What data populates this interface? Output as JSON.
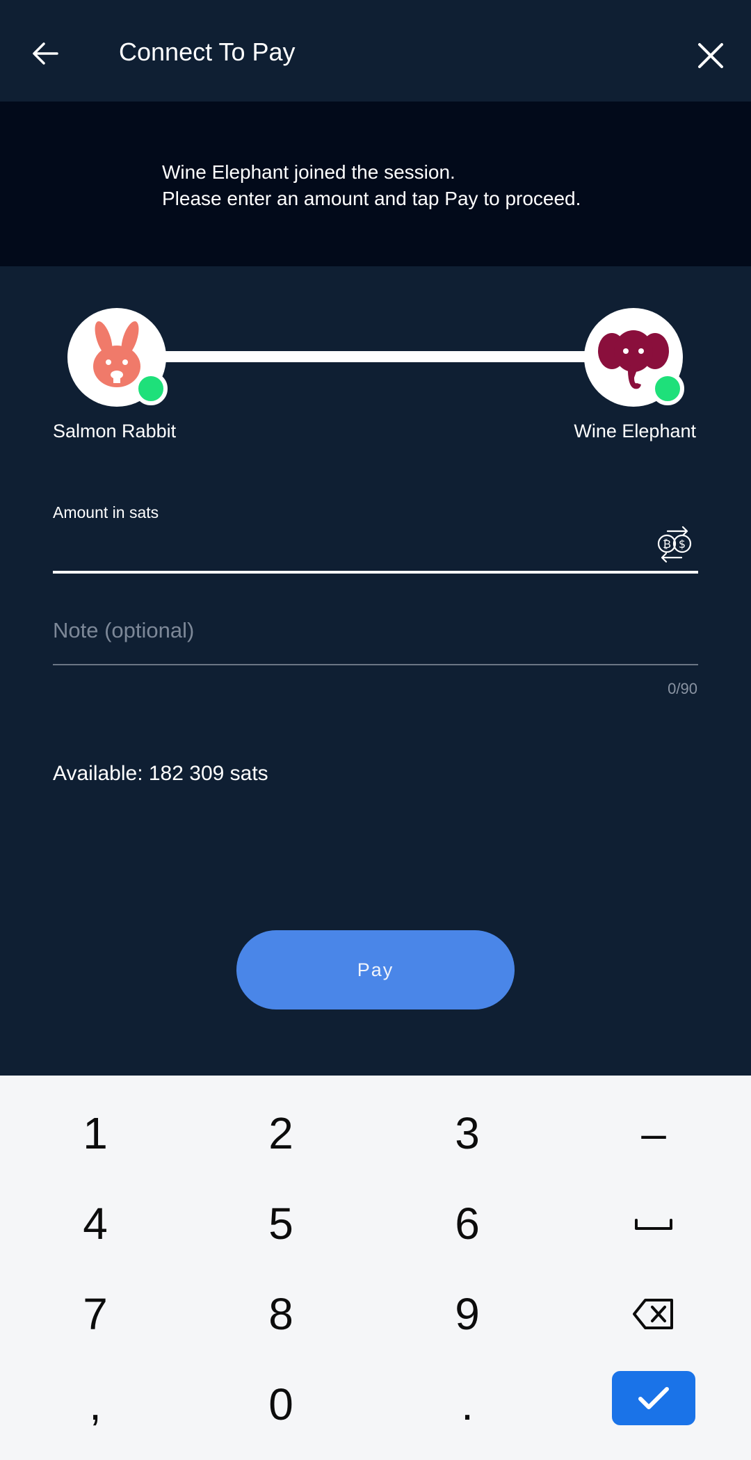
{
  "header": {
    "title": "Connect To Pay",
    "back_icon": "arrow-left-icon",
    "close_icon": "close-icon"
  },
  "banner": {
    "line1": "Wine Elephant joined the session.",
    "line2": "Please enter an amount and tap Pay to proceed."
  },
  "peers": {
    "left": {
      "name": "Salmon Rabbit",
      "avatar_icon": "rabbit-icon",
      "color": "#f07a6a",
      "status": "online"
    },
    "right": {
      "name": "Wine Elephant",
      "avatar_icon": "elephant-icon",
      "color": "#8a0f3c",
      "status": "online"
    },
    "status_color": "#1ee07a"
  },
  "form": {
    "amount_label": "Amount in sats",
    "amount_value": "",
    "currency_toggle_icon": "btc-usd-swap-icon",
    "note_placeholder": "Note (optional)",
    "note_value": "",
    "note_counter": "0/90"
  },
  "available": "Available: 182 309 sats",
  "pay_button": {
    "label": "Pay",
    "color": "#4a86e8"
  },
  "keyboard": {
    "keys": [
      "1",
      "2",
      "3",
      "–",
      "4",
      "5",
      "6",
      "space",
      "7",
      "8",
      "9",
      "backspace",
      ",",
      "0",
      ".",
      "confirm"
    ],
    "confirm_color": "#1a73e8"
  },
  "theme": {
    "background": "#0f1f33",
    "banner": "#020a1a"
  }
}
